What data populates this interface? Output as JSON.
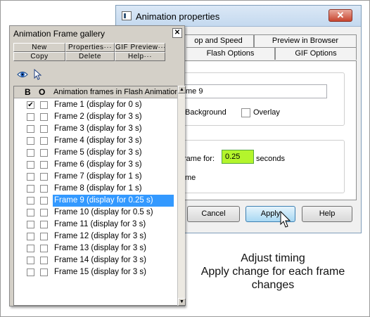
{
  "dialog": {
    "title": "Animation properties",
    "close_label": "✕",
    "tabs_top": [
      "op and Speed",
      "Preview in Browser"
    ],
    "tabs_bottom": [
      "Flash Options",
      "GIF Options"
    ],
    "name_value": "me 9",
    "background_label": "Background",
    "overlay_label": "Overlay",
    "display_frame_label": "rame for:",
    "timing_value": "0.25",
    "seconds_label": "seconds",
    "me_label": "me",
    "cancel_label": "Cancel",
    "apply_label": "Apply",
    "help_label": "Help"
  },
  "gallery": {
    "title": "Animation Frame gallery",
    "close_label": "✕",
    "buttons_row1": [
      "New",
      "Properties···",
      "GIF Preview···"
    ],
    "buttons_row2": [
      "Copy",
      "Delete",
      "Help···"
    ],
    "header": {
      "b": "B",
      "o": "O",
      "title": "Animation frames in Flash Animation"
    },
    "frames": [
      {
        "label": "Frame 1 (display for 0 s)",
        "checked": true,
        "selected": false
      },
      {
        "label": "Frame 2 (display for 3 s)",
        "checked": false,
        "selected": false
      },
      {
        "label": "Frame 3 (display for 3 s)",
        "checked": false,
        "selected": false
      },
      {
        "label": "Frame 4 (display for 3 s)",
        "checked": false,
        "selected": false
      },
      {
        "label": "Frame 5 (display for 3 s)",
        "checked": false,
        "selected": false
      },
      {
        "label": "Frame 6 (display for 3 s)",
        "checked": false,
        "selected": false
      },
      {
        "label": "Frame 7 (display for 1 s)",
        "checked": false,
        "selected": false
      },
      {
        "label": "Frame 8 (display for 1 s)",
        "checked": false,
        "selected": false
      },
      {
        "label": "Frame 9 (display for 0.25 s)",
        "checked": false,
        "selected": true
      },
      {
        "label": "Frame 10 (display for 0.5 s)",
        "checked": false,
        "selected": false
      },
      {
        "label": "Frame 11 (display for 3 s)",
        "checked": false,
        "selected": false
      },
      {
        "label": "Frame 12 (display for 3 s)",
        "checked": false,
        "selected": false
      },
      {
        "label": "Frame 13 (display for 3 s)",
        "checked": false,
        "selected": false
      },
      {
        "label": "Frame 14 (display for 3 s)",
        "checked": false,
        "selected": false
      },
      {
        "label": "Frame 15 (display for 3 s)",
        "checked": false,
        "selected": false
      }
    ],
    "check_glyph": "✔"
  },
  "caption": {
    "line1": "Adjust timing",
    "line2": "Apply change for each frame",
    "line3": "changes"
  },
  "colors": {
    "selection": "#3399ff",
    "timing_field": "#b4f52c",
    "close_button": "#c8452f"
  }
}
